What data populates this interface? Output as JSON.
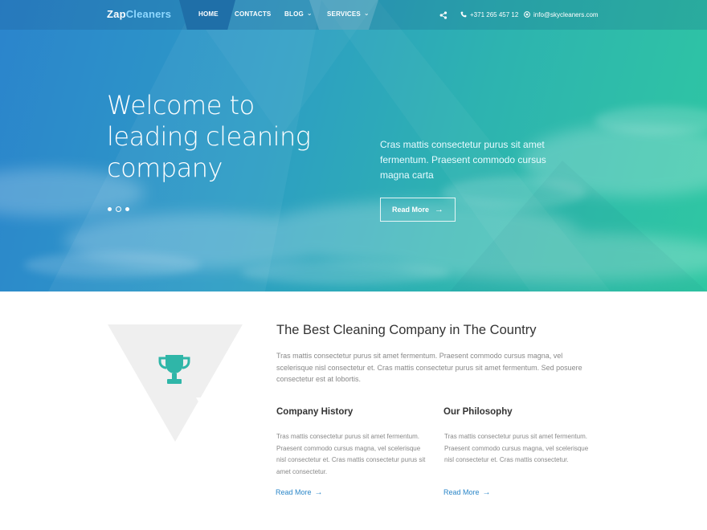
{
  "brand": {
    "logo_part1": "Zap",
    "logo_part2": "Cleaners"
  },
  "nav": {
    "items": [
      {
        "label": "HOME",
        "active": true
      },
      {
        "label": "CONTACTS"
      },
      {
        "label": "BLOG",
        "has_dropdown": true
      },
      {
        "label": "SERVICES",
        "has_dropdown": true
      }
    ],
    "share_icon": "share-icon",
    "phone": "+371 265 457 12",
    "email": "info@skycleaners.com"
  },
  "hero": {
    "title_lines": [
      "Welcome to",
      "leading cleaning",
      "company"
    ],
    "text": "Cras mattis consectetur purus sit amet fermentum. Praesent commodo cursus magna carta",
    "button_label": "Read More",
    "slides_count": 3,
    "active_slide": 2
  },
  "intro": {
    "icon": "trophy-icon",
    "title": "The Best Cleaning Company in The Country",
    "text": "Tras mattis consectetur purus sit amet fermentum. Praesent commodo cursus magna, vel scelerisque nisl consectetur et. Cras mattis consectetur purus sit amet fermentum. Sed posuere consectetur est at lobortis."
  },
  "columns": [
    {
      "title": "Company History",
      "text": "Tras mattis consectetur purus sit amet fermentum. Praesent commodo cursus magna, vel scelerisque nisl consectetur et. Cras mattis consectetur purus sit amet consectetur.",
      "link": "Read More"
    },
    {
      "title": "Our Philosophy",
      "text": "Tras mattis consectetur purus sit amet fermentum. Praesent commodo cursus magna, vel scelerisque nisl consectetur et. Cras mattis consectetur.",
      "link": "Read More"
    }
  ],
  "colors": {
    "accent": "#2a86c8",
    "trophy": "#2fb6a8",
    "hero_start": "#2b84cc",
    "hero_end": "#2fc7a2"
  }
}
